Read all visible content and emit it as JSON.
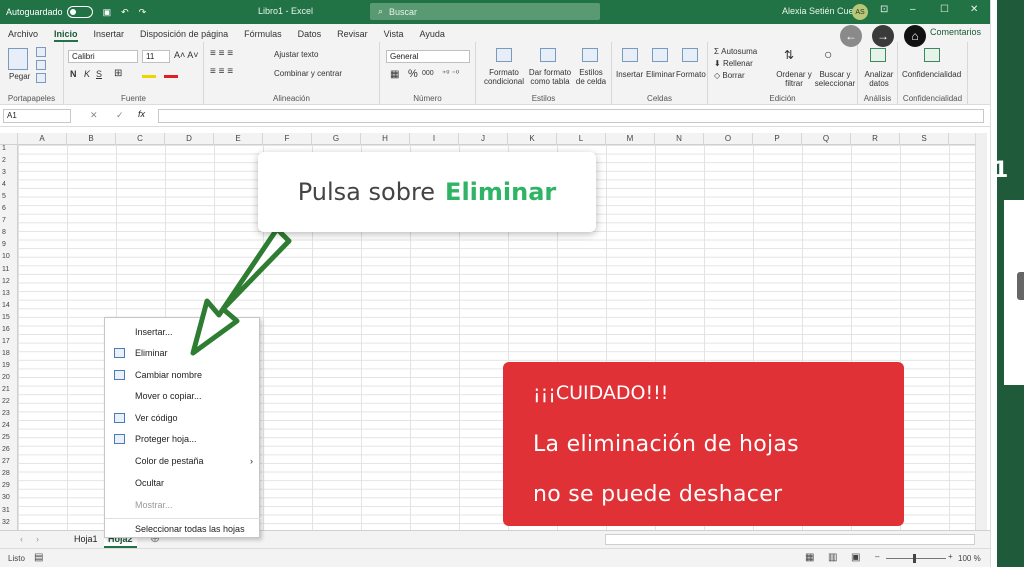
{
  "titlebar": {
    "autosave": "Autoguardado",
    "doc_title": "Libro1 - Excel",
    "search": "Buscar",
    "user": "Alexia Setién Cueva",
    "initials": "AS",
    "min": "–",
    "restore": "☐",
    "close": "✕"
  },
  "menu": [
    "Archivo",
    "Inicio",
    "Insertar",
    "Disposición de página",
    "Fórmulas",
    "Datos",
    "Revisar",
    "Vista",
    "Ayuda"
  ],
  "comments_label": "Comentarios",
  "ribbon": {
    "clipboard": {
      "paste": "Pegar",
      "label": "Portapapeles"
    },
    "font": {
      "name": "Calibri",
      "size": "11",
      "label": "Fuente",
      "bold": "N",
      "italic": "K",
      "underline": "S"
    },
    "alignment": {
      "wrap": "Ajustar texto",
      "merge": "Combinar y centrar",
      "label": "Alineación"
    },
    "number": {
      "format": "General",
      "label": "Número",
      "pct": "%",
      "thousands": "000"
    },
    "styles": {
      "cond": "Formato condicional",
      "table": "Dar formato como tabla",
      "cell": "Estilos de celda",
      "label": "Estilos"
    },
    "cells": {
      "insert": "Insertar",
      "delete": "Eliminar",
      "format": "Formato",
      "label": "Celdas"
    },
    "editing": {
      "autosum": "Autosuma",
      "fill": "Rellenar",
      "clear": "Borrar",
      "sort": "Ordenar y filtrar",
      "find": "Buscar y seleccionar",
      "label": "Edición"
    },
    "analysis": {
      "analyze": "Analizar datos",
      "label": "Análisis"
    },
    "privacy": {
      "conf": "Confidencialidad",
      "label": "Confidencialidad"
    }
  },
  "formula": {
    "cell": "A1",
    "fx": "fx"
  },
  "columns": [
    "A",
    "B",
    "C",
    "D",
    "E",
    "F",
    "G",
    "H",
    "I",
    "J",
    "K",
    "L",
    "M",
    "N",
    "O",
    "P",
    "Q",
    "R",
    "S"
  ],
  "rows": [
    "1",
    "2",
    "3",
    "4",
    "5",
    "6",
    "7",
    "8",
    "9",
    "10",
    "11",
    "12",
    "13",
    "14",
    "15",
    "16",
    "17",
    "18",
    "19",
    "20",
    "21",
    "22",
    "23",
    "24",
    "25",
    "26",
    "27",
    "28",
    "29",
    "30",
    "31",
    "32"
  ],
  "context_menu": [
    {
      "label": "Insertar...",
      "icon": "",
      "disabled": false
    },
    {
      "label": "Eliminar",
      "icon": "delete-sheet-icon",
      "disabled": false
    },
    {
      "label": "Cambiar nombre",
      "icon": "rename-icon",
      "disabled": false
    },
    {
      "label": "Mover o copiar...",
      "icon": "",
      "disabled": false
    },
    {
      "label": "Ver código",
      "icon": "view-code-icon",
      "disabled": false
    },
    {
      "label": "Proteger hoja...",
      "icon": "protect-sheet-icon",
      "disabled": false
    },
    {
      "label": "Color de pestaña",
      "icon": "",
      "disabled": false,
      "submenu": "›"
    },
    {
      "label": "Ocultar",
      "icon": "",
      "disabled": false
    },
    {
      "label": "Mostrar...",
      "icon": "",
      "disabled": true
    },
    {
      "label": "Seleccionar todas las hojas",
      "icon": "",
      "disabled": false
    }
  ],
  "sheets": [
    "Hoja1",
    "Hoja2"
  ],
  "status": {
    "ready": "Listo",
    "zoom": "100 %"
  },
  "callout": {
    "prefix": "Pulsa sobre",
    "highlight": "Eliminar"
  },
  "warning": {
    "line1": "¡¡¡CUIDADO!!!",
    "line2": "La eliminación de hojas",
    "line3": "no se puede deshacer"
  },
  "step_number": "1",
  "colors": {
    "excel_green": "#217346",
    "warning_red": "#e03136",
    "highlight_green": "#2fb465",
    "arrow_green": "#2e7d32"
  }
}
